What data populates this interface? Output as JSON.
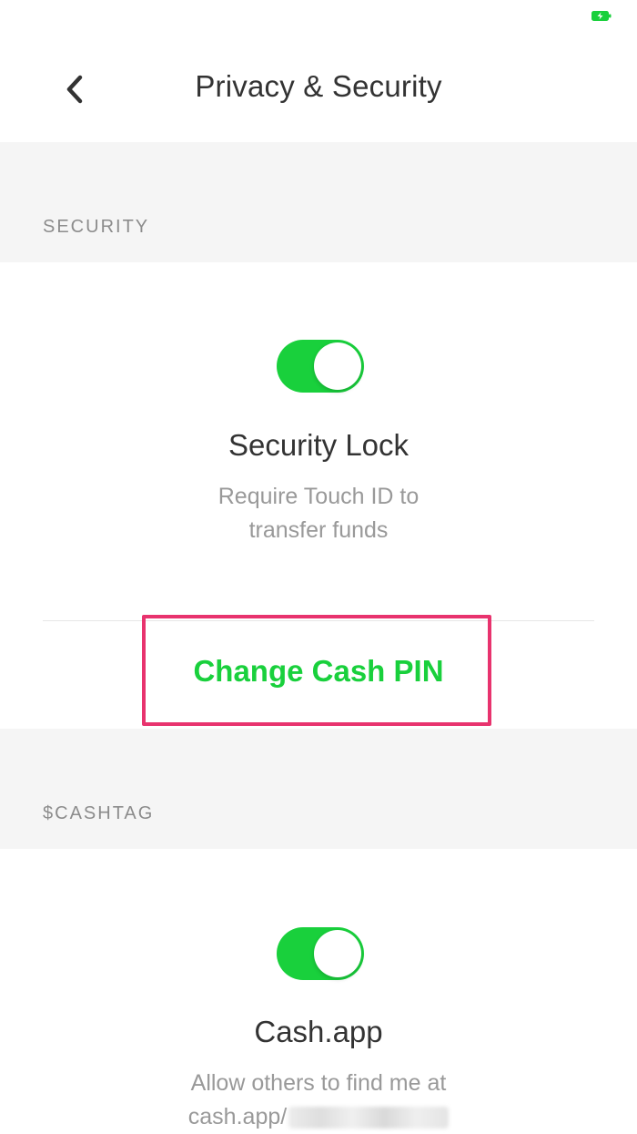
{
  "header": {
    "title": "Privacy & Security"
  },
  "sections": {
    "security": {
      "label": "SECURITY",
      "security_lock": {
        "title": "Security Lock",
        "description_line1": "Require Touch ID to",
        "description_line2": "transfer funds",
        "enabled": true
      },
      "change_pin_label": "Change Cash PIN"
    },
    "cashtag": {
      "label": "$CASHTAG",
      "cash_app": {
        "title": "Cash.app",
        "description_line1": "Allow others to find me at",
        "description_line2_prefix": "cash.app/",
        "enabled": true
      }
    }
  },
  "colors": {
    "accent_green": "#19d03c",
    "highlight_pink": "#e8336e",
    "section_bg": "#f5f5f5"
  },
  "icons": {
    "back": "chevron-left-icon",
    "battery": "battery-charging-icon"
  }
}
